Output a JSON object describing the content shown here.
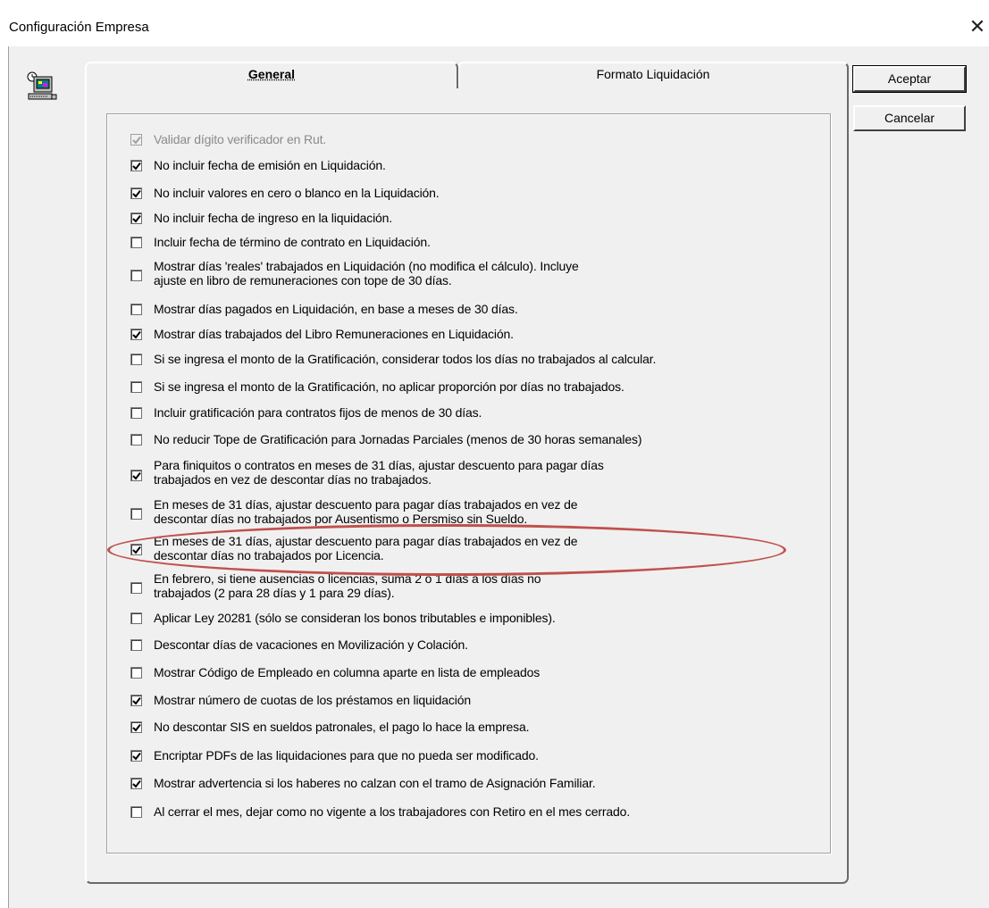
{
  "window": {
    "title": "Configuración Empresa",
    "close_glyph": "✕",
    "icon": "computer-terminal-icon"
  },
  "tabs": [
    {
      "label": "General",
      "active": true
    },
    {
      "label": "Formato Liquidación",
      "active": false
    }
  ],
  "buttons": {
    "accept": "Aceptar",
    "cancel": "Cancelar"
  },
  "options": [
    {
      "text": "Validar dígito verificador en Rut.",
      "checked": true,
      "disabled": true
    },
    {
      "text": "No incluir fecha de emisión en Liquidación.",
      "checked": true,
      "disabled": false
    },
    {
      "text": "No incluir valores en cero o blanco en la Liquidación.",
      "checked": true,
      "disabled": false
    },
    {
      "text": "No incluir fecha de ingreso en la liquidación.",
      "checked": true,
      "disabled": false
    },
    {
      "text": "Incluir fecha de término de contrato en Liquidación.",
      "checked": false,
      "disabled": false
    },
    {
      "text": "Mostrar días 'reales' trabajados en Liquidación (no modifica el cálculo). Incluye\najuste en libro de remuneraciones con tope de 30 días.",
      "checked": false,
      "disabled": false
    },
    {
      "text": "Mostrar días pagados en Liquidación, en base a meses de 30 días.",
      "checked": false,
      "disabled": false
    },
    {
      "text": "Mostrar días trabajados del Libro Remuneraciones en Liquidación.",
      "checked": true,
      "disabled": false
    },
    {
      "text": "Si se ingresa el monto de la Gratificación, considerar todos los días no trabajados al calcular.",
      "checked": false,
      "disabled": false
    },
    {
      "text": "Si se ingresa el monto de la Gratificación, no aplicar proporción por días no trabajados.",
      "checked": false,
      "disabled": false
    },
    {
      "text": "Incluir gratificación para contratos fijos de menos de 30 días.",
      "checked": false,
      "disabled": false
    },
    {
      "text": "No reducir Tope de Gratificación para Jornadas Parciales (menos de 30 horas semanales)",
      "checked": false,
      "disabled": false
    },
    {
      "text": "Para finiquitos o contratos en meses de 31 días, ajustar descuento para pagar días\ntrabajados en vez de descontar días no trabajados.",
      "checked": true,
      "disabled": false
    },
    {
      "text": "En meses de 31 días, ajustar descuento para pagar días trabajados en vez de\ndescontar días no trabajados por Ausentismo o Persmiso sin Sueldo.",
      "checked": false,
      "disabled": false
    },
    {
      "text": "En meses de 31 días, ajustar descuento para pagar días trabajados en vez de\ndescontar días no trabajados por Licencia.",
      "checked": true,
      "disabled": false,
      "highlighted": true
    },
    {
      "text": "En febrero, si tiene ausencias o licencias, suma 2 o 1 días a los días no\ntrabajados (2 para 28 días y 1 para 29 días).",
      "checked": false,
      "disabled": false
    },
    {
      "text": "Aplicar Ley 20281 (sólo se consideran los bonos tributables e imponibles).",
      "checked": false,
      "disabled": false
    },
    {
      "text": "Descontar días de vacaciones en Movilización y Colación.",
      "checked": false,
      "disabled": false
    },
    {
      "text": "Mostrar Código de Empleado en columna aparte en lista de empleados",
      "checked": false,
      "disabled": false
    },
    {
      "text": "Mostrar  número de cuotas de los préstamos en liquidación",
      "checked": true,
      "disabled": false
    },
    {
      "text": "No descontar SIS en sueldos patronales, el pago lo hace la empresa.",
      "checked": true,
      "disabled": false
    },
    {
      "text": "Encriptar PDFs de las liquidaciones para que no pueda ser modificado.",
      "checked": true,
      "disabled": false
    },
    {
      "text": "Mostrar advertencia si los haberes no calzan con el tramo de Asignación Familiar.",
      "checked": true,
      "disabled": false
    },
    {
      "text": "Al cerrar el mes, dejar como no vigente a los trabajadores con Retiro en el mes cerrado.",
      "checked": false,
      "disabled": false
    }
  ],
  "colors": {
    "dialog_bg": "#f0f0f0",
    "highlight": "#c0504d",
    "disabled_text": "#8a8a8a"
  }
}
